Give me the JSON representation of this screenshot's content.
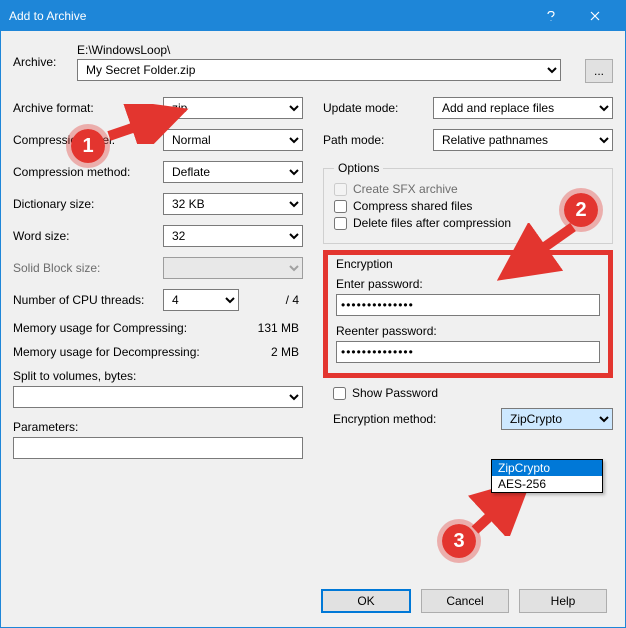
{
  "title": "Add to Archive",
  "archive": {
    "label": "Archive:",
    "path": "E:\\WindowsLoop\\",
    "filename": "My Secret Folder.zip"
  },
  "left": {
    "archive_format": {
      "label": "Archive format:",
      "value": "zip"
    },
    "compression_level": {
      "label": "Compression level:",
      "value": "Normal"
    },
    "compression_method": {
      "label": "Compression method:",
      "value": "Deflate"
    },
    "dictionary_size": {
      "label": "Dictionary size:",
      "value": "32 KB"
    },
    "word_size": {
      "label": "Word size:",
      "value": "32"
    },
    "solid_block_size": {
      "label": "Solid Block size:",
      "value": ""
    },
    "cpu_threads": {
      "label": "Number of CPU threads:",
      "value": "4",
      "max": "/ 4"
    },
    "mem_compress": {
      "label": "Memory usage for Compressing:",
      "value": "131 MB"
    },
    "mem_decompress": {
      "label": "Memory usage for Decompressing:",
      "value": "2 MB"
    },
    "split_volumes": {
      "label": "Split to volumes, bytes:",
      "value": ""
    },
    "parameters": {
      "label": "Parameters:",
      "value": ""
    }
  },
  "right": {
    "update_mode": {
      "label": "Update mode:",
      "value": "Add and replace files"
    },
    "path_mode": {
      "label": "Path mode:",
      "value": "Relative pathnames"
    },
    "options": {
      "legend": "Options",
      "sfx": "Create SFX archive",
      "compress_shared": "Compress shared files",
      "delete_after": "Delete files after compression"
    },
    "encryption": {
      "legend": "Encryption",
      "enter_pw": "Enter password:",
      "reenter_pw": "Reenter password:",
      "pw_mask": "••••••••••••••",
      "show_pw": "Show Password",
      "method_label": "Encryption method:",
      "method_value": "ZipCrypto",
      "options": [
        "ZipCrypto",
        "AES-256"
      ]
    }
  },
  "buttons": {
    "ok": "OK",
    "cancel": "Cancel",
    "help": "Help"
  },
  "badges": {
    "b1": "1",
    "b2": "2",
    "b3": "3"
  }
}
